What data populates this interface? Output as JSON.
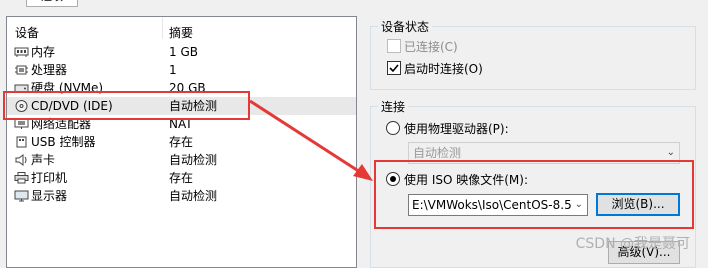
{
  "top_tab": {
    "label": "选项"
  },
  "device_list": {
    "col_device": "设备",
    "col_summary": "摘要",
    "rows": [
      {
        "icon": "memory-icon",
        "name": "内存",
        "summary": "1 GB"
      },
      {
        "icon": "processor-icon",
        "name": "处理器",
        "summary": "1"
      },
      {
        "icon": "harddisk-icon",
        "name": "硬盘 (NVMe)",
        "summary": "20 GB"
      },
      {
        "icon": "cd-dvd-icon",
        "name": "CD/DVD (IDE)",
        "summary": "自动检测"
      },
      {
        "icon": "network-adapter-icon",
        "name": "网络适配器",
        "summary": "NAT"
      },
      {
        "icon": "usb-icon",
        "name": "USB 控制器",
        "summary": "存在"
      },
      {
        "icon": "sound-card-icon",
        "name": "声卡",
        "summary": "自动检测"
      },
      {
        "icon": "printer-icon",
        "name": "打印机",
        "summary": "存在"
      },
      {
        "icon": "display-icon",
        "name": "显示器",
        "summary": "自动检测"
      }
    ]
  },
  "device_status": {
    "title": "设备状态",
    "connected_label": "已连接(C)",
    "connect_on_power_label": "启动时连接(O)"
  },
  "connection": {
    "title": "连接",
    "physical_drive_label": "使用物理驱动器(P):",
    "physical_drive_value": "自动检测",
    "iso_label": "使用 ISO 映像文件(M):",
    "iso_path": "E:\\VMWoks\\Iso\\CentOS-8.5",
    "browse_label": "浏览(B)...",
    "advanced_label": "高级(V)..."
  },
  "watermark": "CSDN @我是聂可",
  "colors": {
    "annotation_red": "#e53935",
    "focus_blue": "#0078d7"
  }
}
